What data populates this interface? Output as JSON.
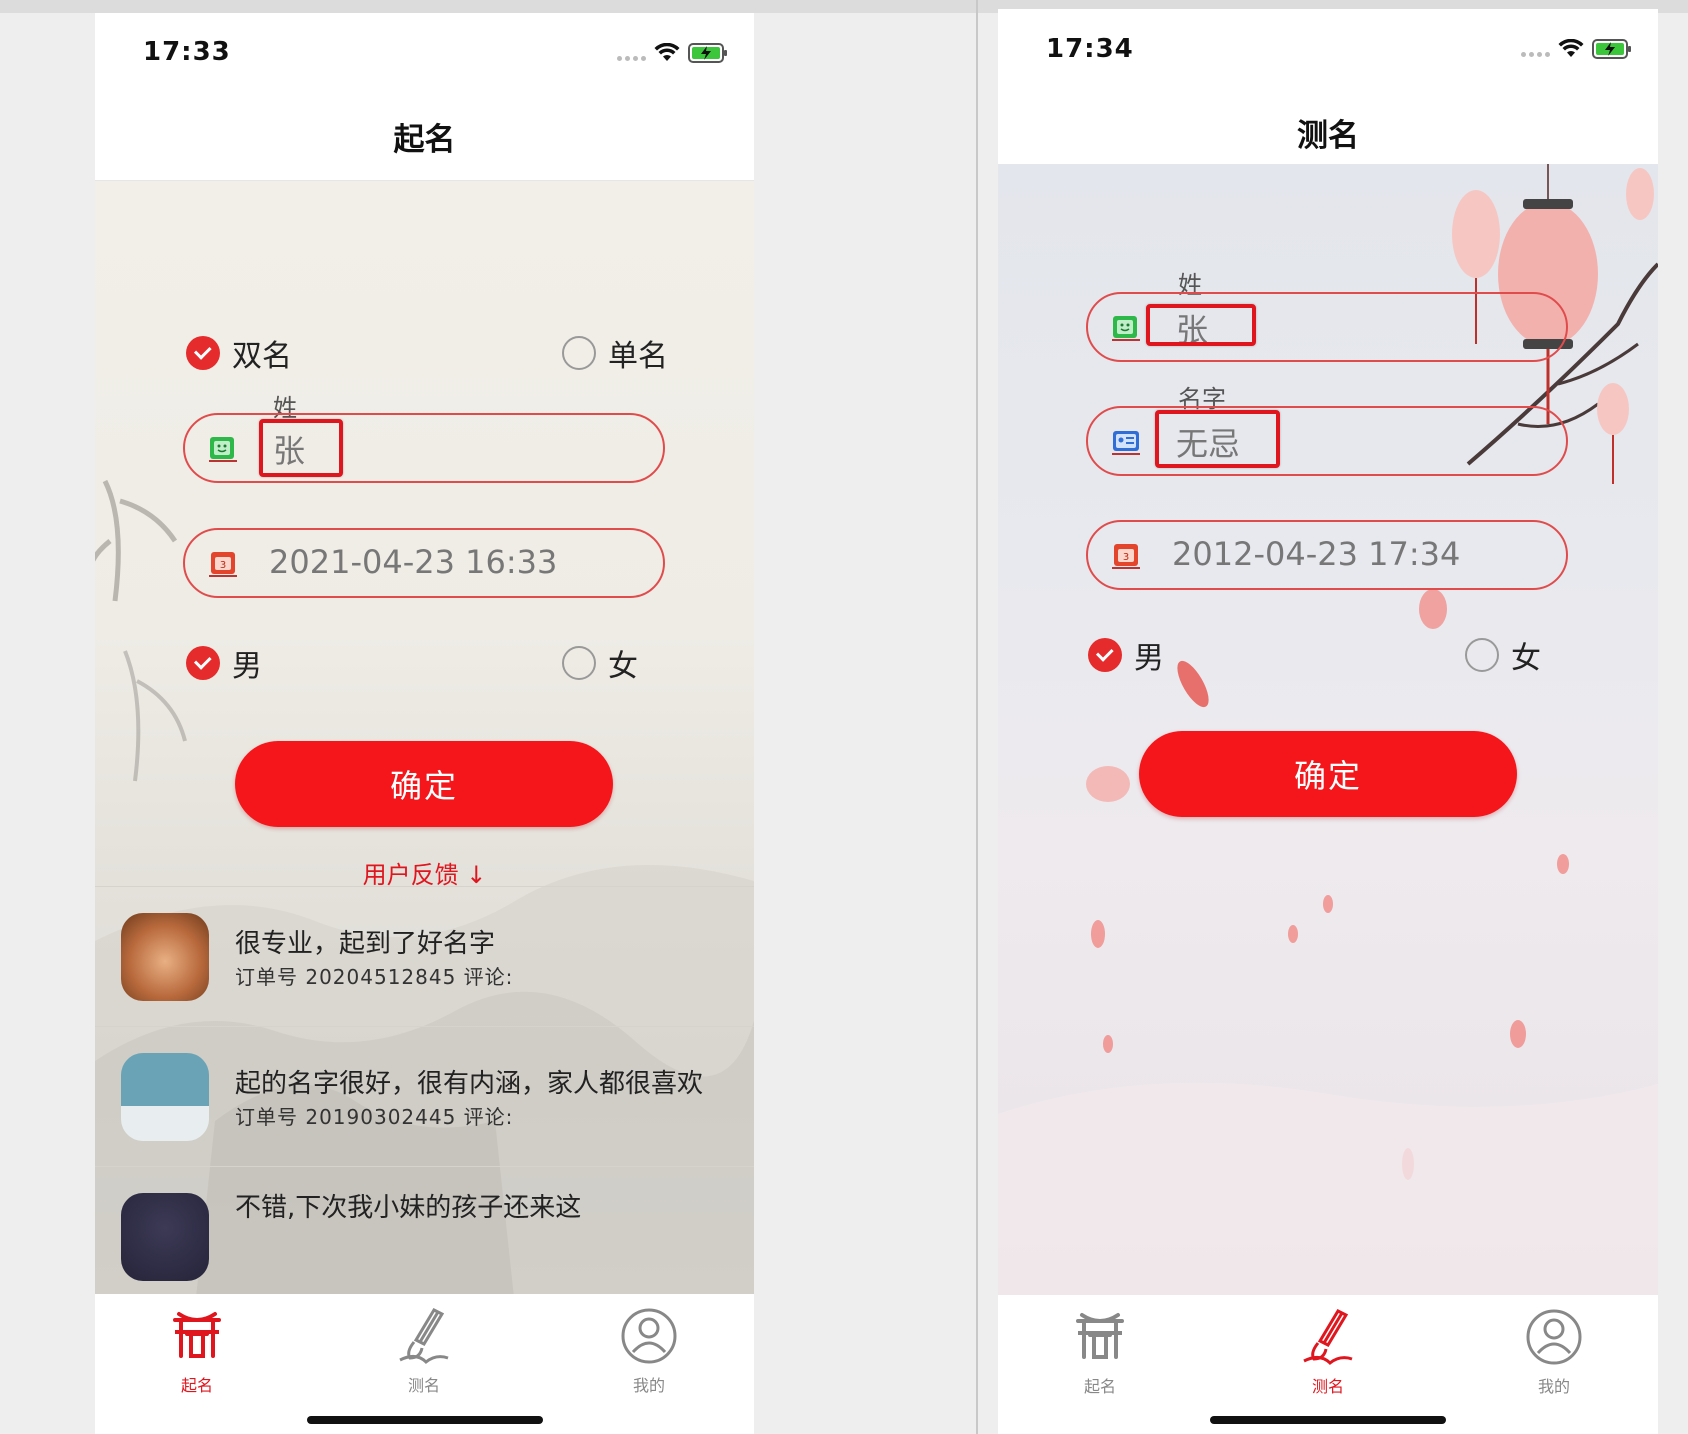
{
  "left_screen": {
    "status_time": "17:33",
    "nav_title": "起名",
    "name_type_options": [
      {
        "label": "双名",
        "checked": true
      },
      {
        "label": "单名",
        "checked": false
      }
    ],
    "surname_label": "姓",
    "surname_value": "张",
    "datetime_value": "2021-04-23 16:33",
    "gender_options": [
      {
        "label": "男",
        "checked": true
      },
      {
        "label": "女",
        "checked": false
      }
    ],
    "confirm_label": "确定",
    "feedback_header": "用户反馈 ↓",
    "feedback": [
      {
        "text": "很专业，起到了好名字",
        "order": "订单号  20204512845  评论:"
      },
      {
        "text": "起的名字很好，很有内涵，家人都很喜欢",
        "order": "订单号  20190302445  评论:"
      },
      {
        "text": "不错,下次我小妹的孩子还来这",
        "order": ""
      }
    ],
    "tabs": [
      {
        "label": "起名",
        "icon": "gate-icon",
        "active": true
      },
      {
        "label": "测名",
        "icon": "brush-icon",
        "active": false
      },
      {
        "label": "我的",
        "icon": "user-icon",
        "active": false
      }
    ]
  },
  "right_screen": {
    "status_time": "17:34",
    "nav_title": "测名",
    "surname_label": "姓",
    "surname_value": "张",
    "given_name_label": "名字",
    "given_name_value": "无忌",
    "datetime_value": "2012-04-23 17:34",
    "gender_options": [
      {
        "label": "男",
        "checked": true
      },
      {
        "label": "女",
        "checked": false
      }
    ],
    "confirm_label": "确定",
    "tabs": [
      {
        "label": "起名",
        "icon": "gate-icon",
        "active": false
      },
      {
        "label": "测名",
        "icon": "brush-icon",
        "active": true
      },
      {
        "label": "我的",
        "icon": "user-icon",
        "active": false
      }
    ]
  },
  "colors": {
    "accent": "#f5161c",
    "highlight_box": "#e0161f",
    "field_border": "#e04c4c",
    "inactive_tab": "#888888"
  }
}
